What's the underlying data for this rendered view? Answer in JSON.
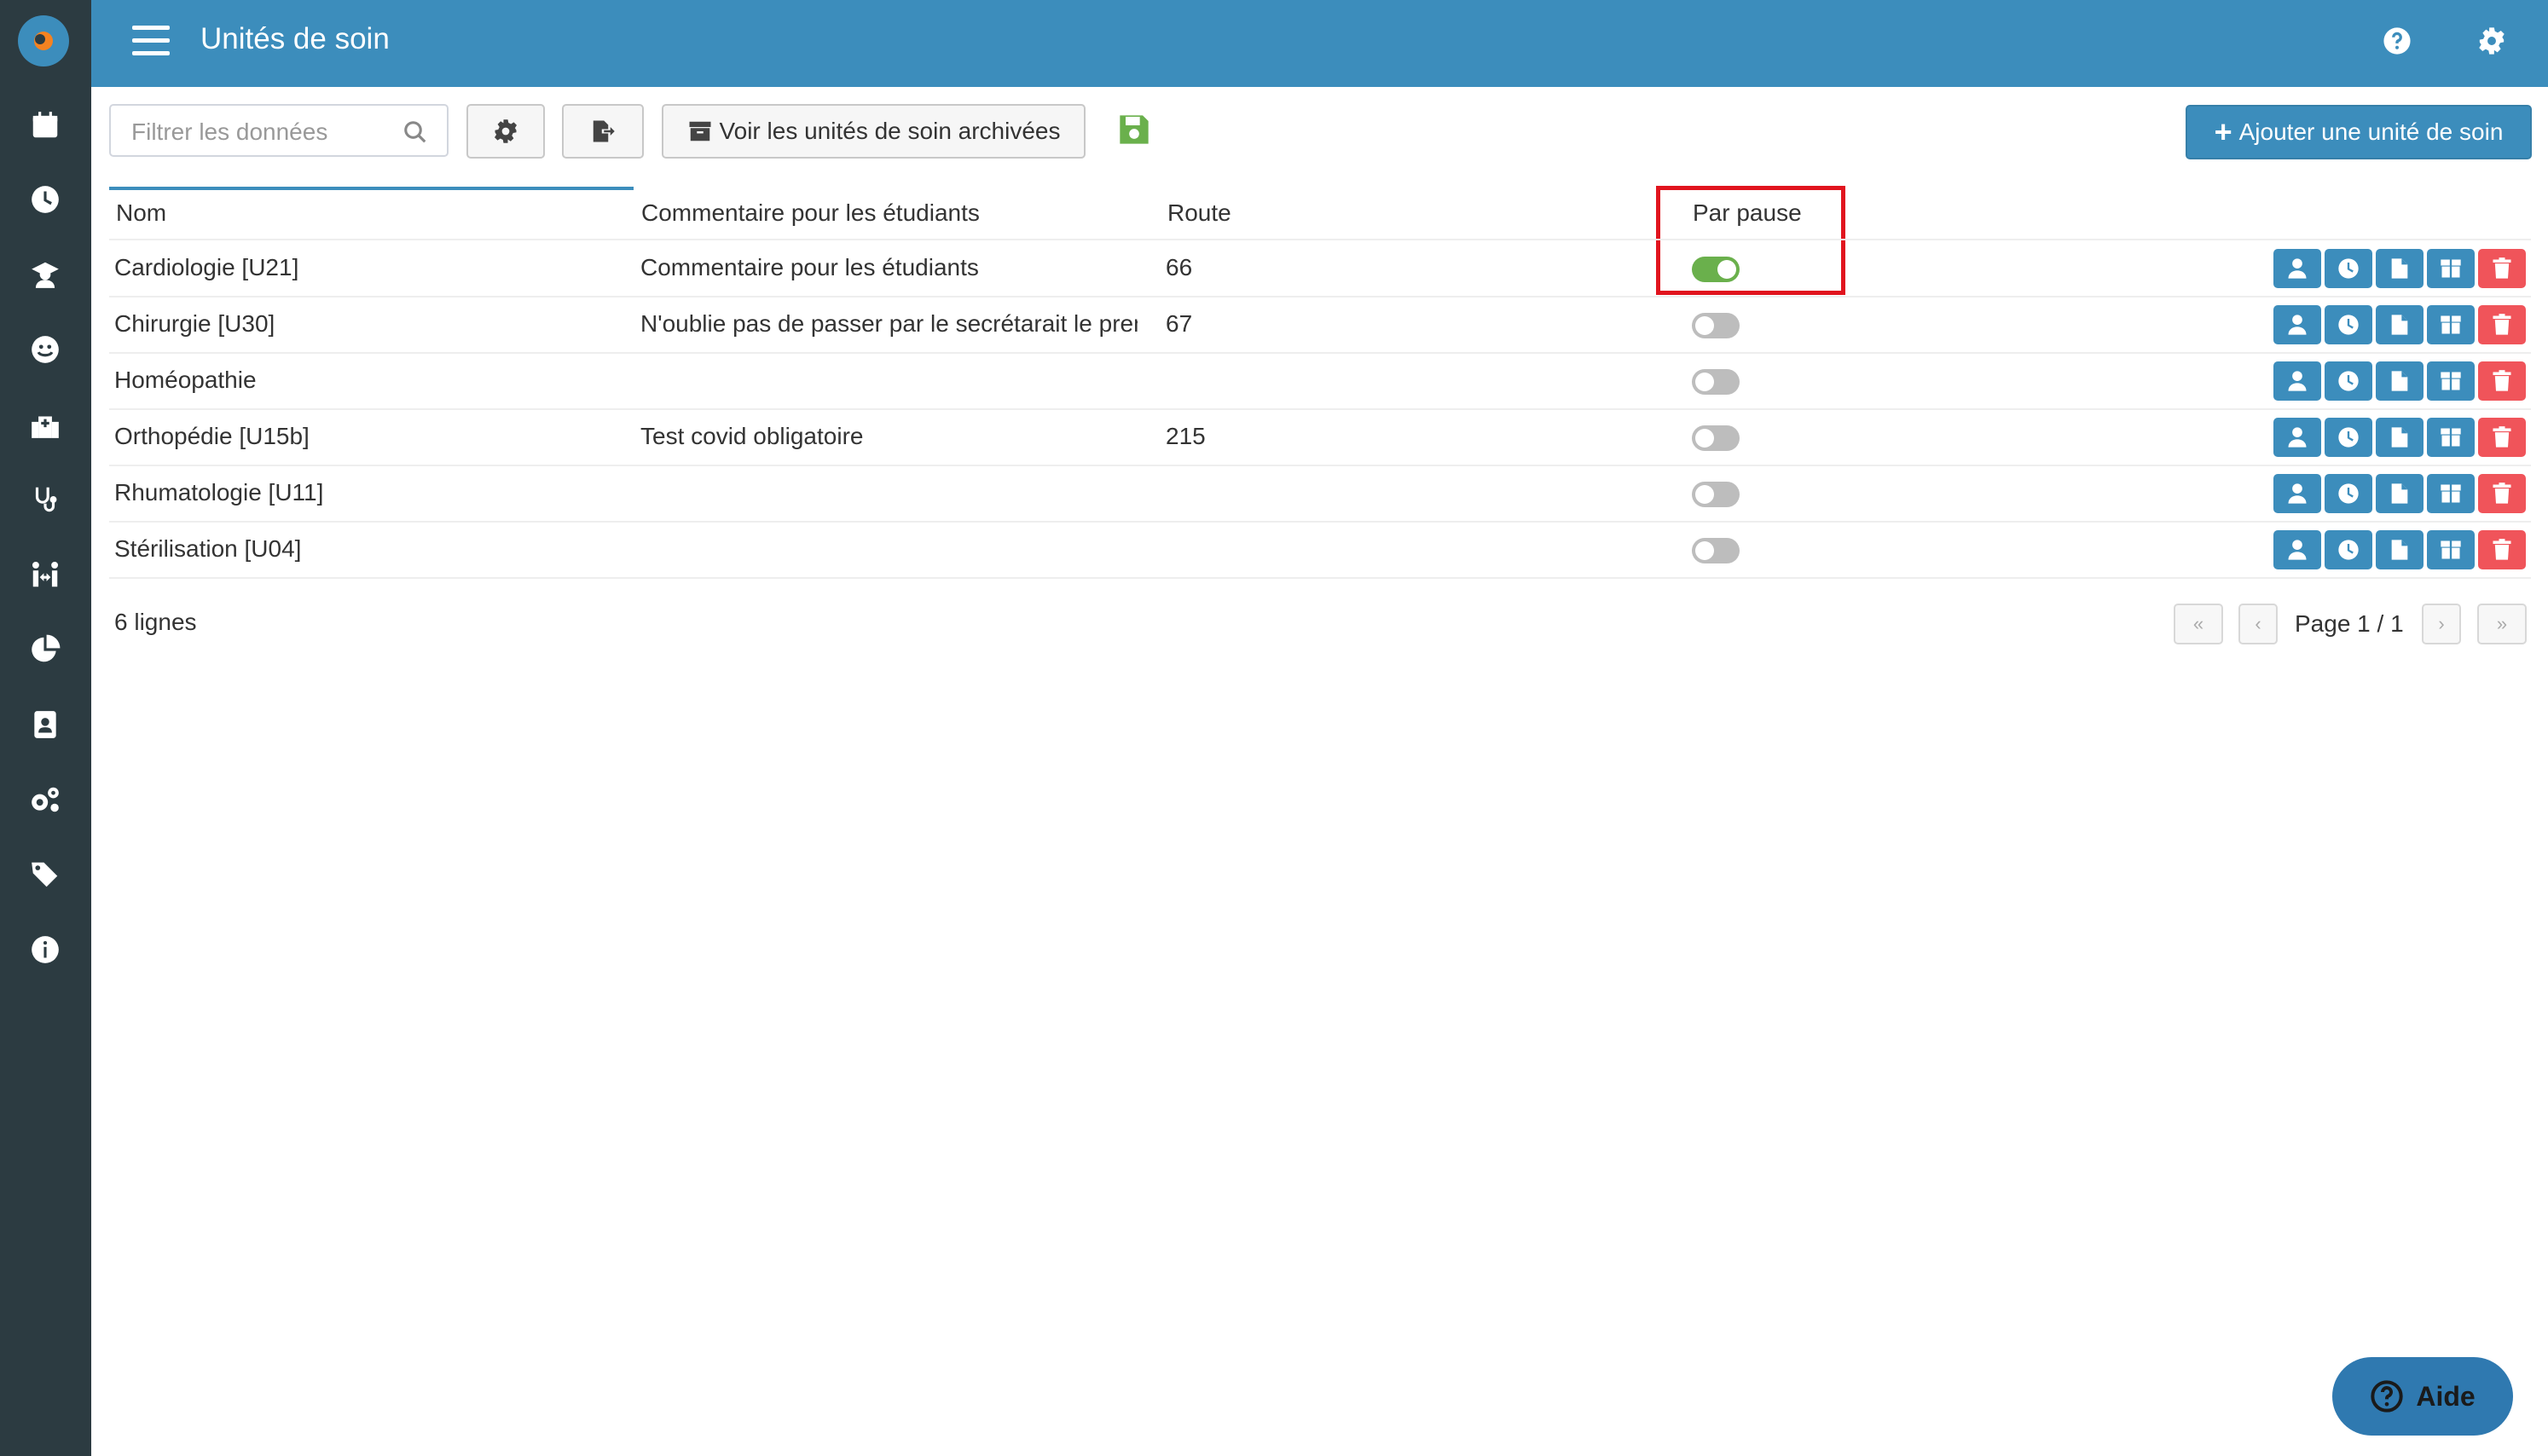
{
  "header": {
    "title": "Unités de soin"
  },
  "sidebar": {
    "items": [
      {
        "icon": "calendar-icon"
      },
      {
        "icon": "clock-icon"
      },
      {
        "icon": "graduate-icon"
      },
      {
        "icon": "smiley-icon"
      },
      {
        "icon": "hospital-icon"
      },
      {
        "icon": "stethoscope-icon"
      },
      {
        "icon": "people-arrows-icon"
      },
      {
        "icon": "chart-pie-icon"
      },
      {
        "icon": "id-badge-icon"
      },
      {
        "icon": "cogs-icon"
      },
      {
        "icon": "tags-icon"
      },
      {
        "icon": "info-icon"
      }
    ]
  },
  "toolbar": {
    "filter_placeholder": "Filtrer les données",
    "archived_label": "Voir les unités de soin archivées",
    "add_label": "Ajouter une unité de soin"
  },
  "table": {
    "columns": [
      "Nom",
      "Commentaire pour les étudiants",
      "Route",
      "Par pause"
    ],
    "rows": [
      {
        "nom": "Cardiologie [U21]",
        "commentaire": "Commentaire pour les étudiants",
        "route": "66",
        "par_pause": true
      },
      {
        "nom": "Chirurgie [U30]",
        "commentaire": "N'oublie pas de passer par le secrétarait le pren",
        "route": "67",
        "par_pause": false
      },
      {
        "nom": "Homéopathie",
        "commentaire": "",
        "route": "",
        "par_pause": false
      },
      {
        "nom": "Orthopédie [U15b]",
        "commentaire": "Test covid obligatoire",
        "route": "215",
        "par_pause": false
      },
      {
        "nom": "Rhumatologie [U11]",
        "commentaire": "",
        "route": "",
        "par_pause": false
      },
      {
        "nom": "Stérilisation [U04]",
        "commentaire": "",
        "route": "",
        "par_pause": false
      }
    ]
  },
  "footer": {
    "rows_count": "6 lignes",
    "page_info": "Page 1 / 1"
  },
  "help": {
    "label": "Aide"
  },
  "colors": {
    "header": "#3c8dbc",
    "sidebar": "#2c3b41",
    "toggle_on": "#6ab04c",
    "delete": "#f0545a",
    "highlight": "#e1141e"
  }
}
